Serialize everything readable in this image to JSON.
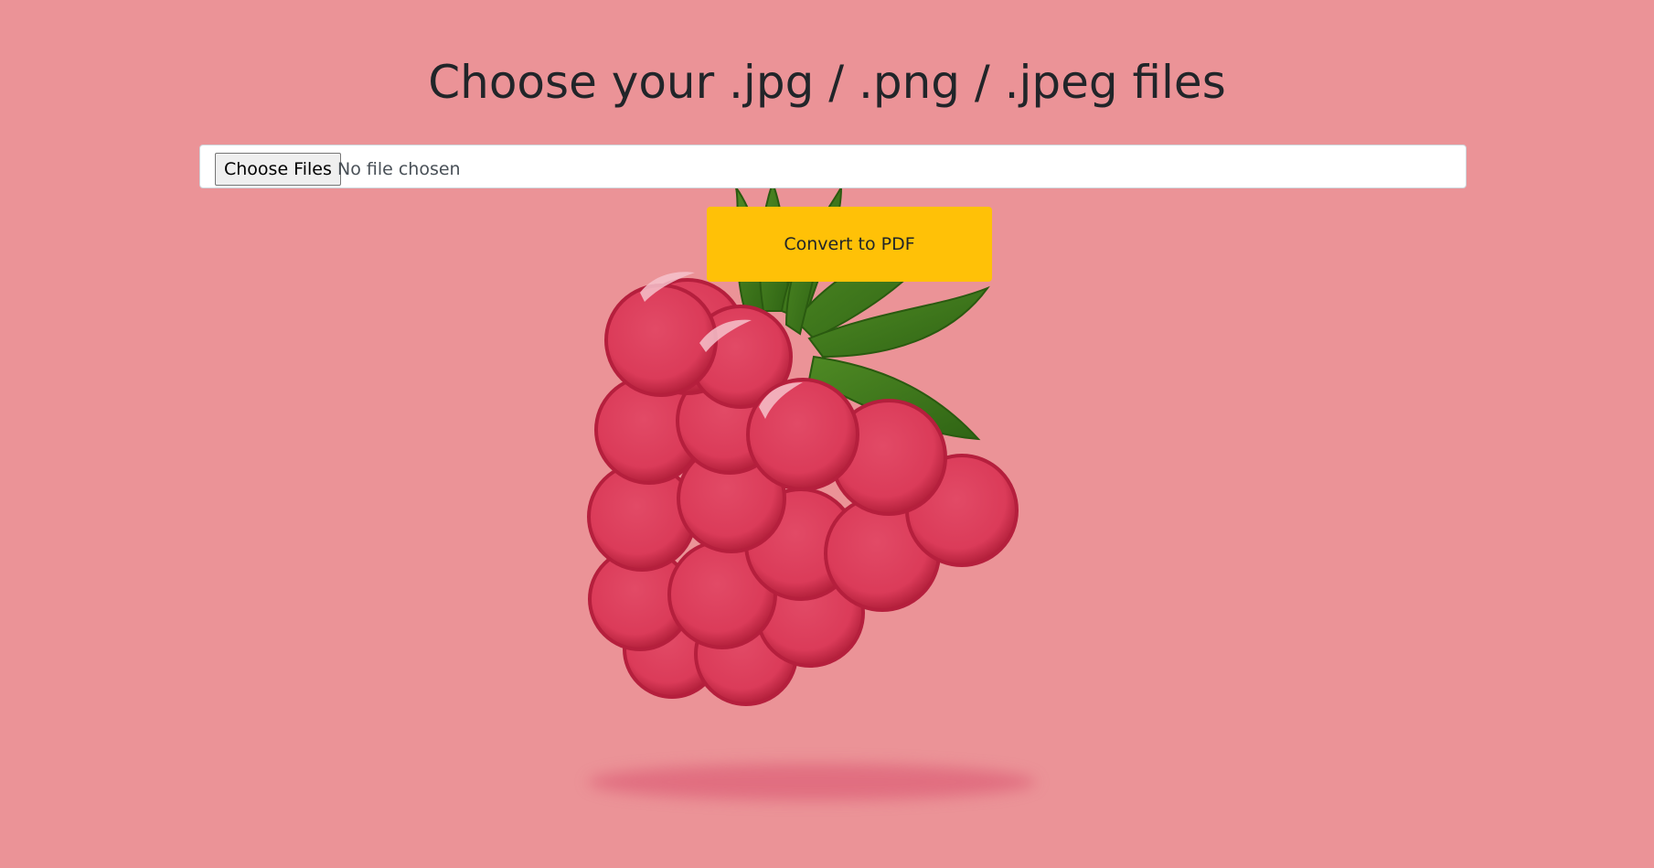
{
  "heading": "Choose your .jpg / .png / .jpeg files",
  "file_input": {
    "button_label": "Choose Files",
    "status": "No file chosen",
    "accept": ".jpg,.png,.jpeg"
  },
  "convert_button": {
    "label": "Convert to PDF"
  },
  "background": {
    "image": "raspberry-illustration"
  },
  "colors": {
    "background": "#eb9397",
    "button_accent": "#ffc107",
    "heading_text": "#212529"
  }
}
